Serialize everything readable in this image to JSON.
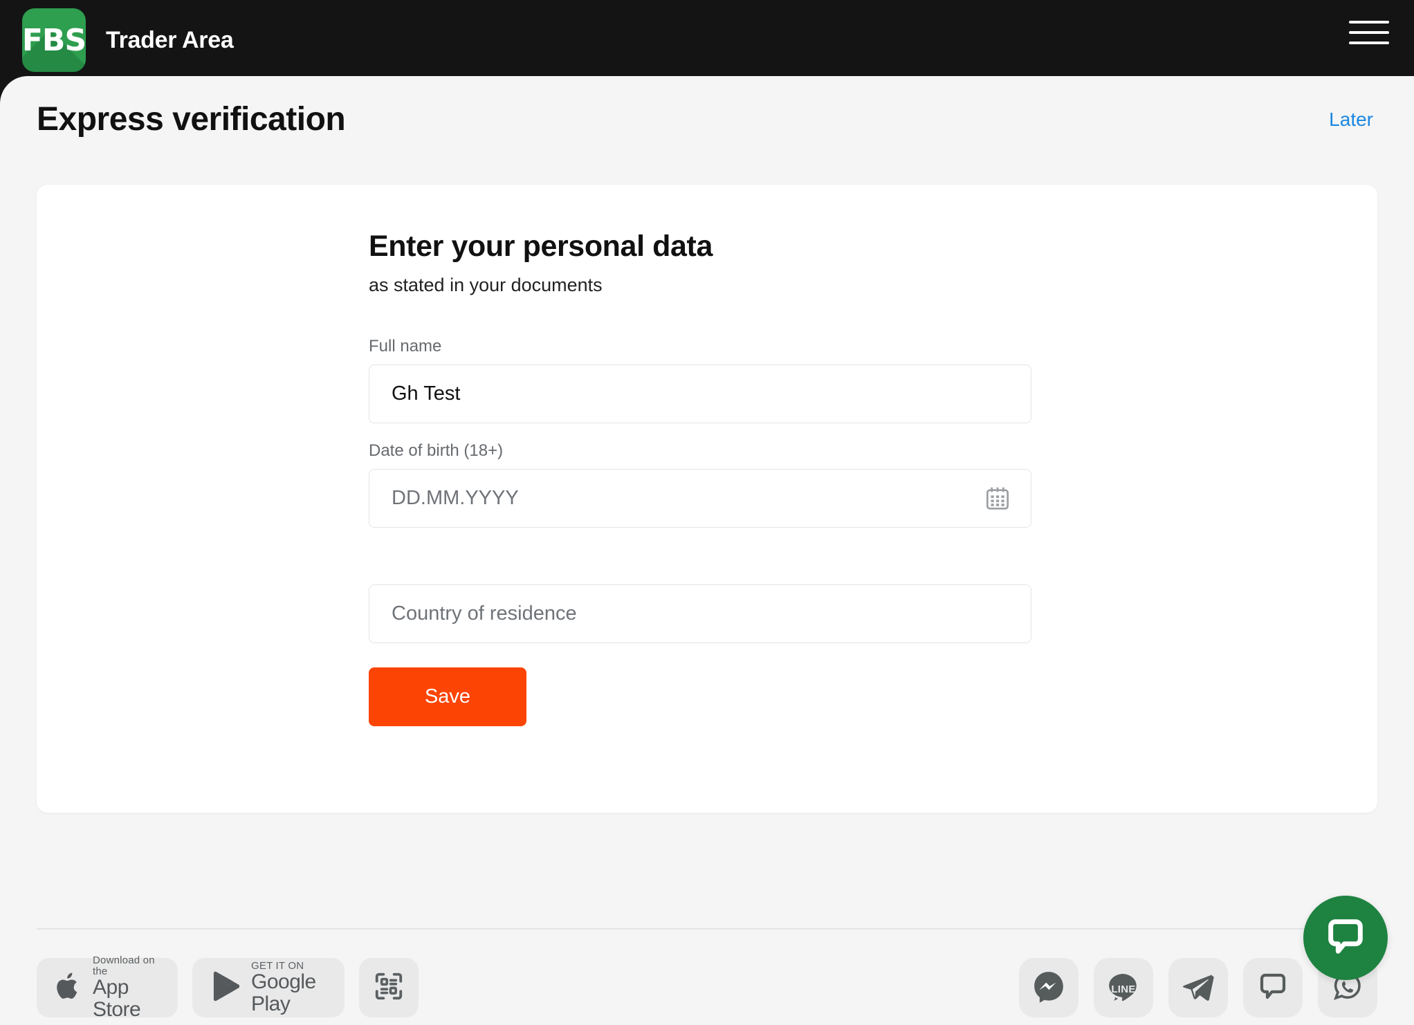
{
  "header": {
    "logo_text": "FBS",
    "brand_title": "Trader Area",
    "menu_icon": "hamburger-menu-icon"
  },
  "page": {
    "title": "Express verification",
    "later_label": "Later"
  },
  "form": {
    "title": "Enter your personal data",
    "subtitle": "as stated in your documents",
    "full_name": {
      "label": "Full name",
      "value": "Gh Test",
      "placeholder": "Full name"
    },
    "date_of_birth": {
      "label": "Date of birth (18+)",
      "value": "",
      "placeholder": "DD.MM.YYYY",
      "icon": "calendar-icon"
    },
    "country": {
      "label": "",
      "value": "",
      "placeholder": "Country of residence"
    },
    "save_label": "Save"
  },
  "footer": {
    "app_store": {
      "small": "Download on the",
      "big": "App Store",
      "icon": "apple-icon"
    },
    "google_play": {
      "small": "GET IT ON",
      "big": "Google Play",
      "icon": "google-play-icon"
    },
    "qr": {
      "icon": "qr-scan-icon"
    },
    "socials": [
      {
        "name": "messenger",
        "icon": "messenger-icon"
      },
      {
        "name": "line",
        "icon": "line-icon",
        "label": "LINE"
      },
      {
        "name": "telegram",
        "icon": "telegram-icon"
      },
      {
        "name": "chat",
        "icon": "chat-bubble-icon"
      },
      {
        "name": "whatsapp",
        "icon": "whatsapp-icon"
      }
    ]
  },
  "chat_widget": {
    "icon": "chat-bubble-icon"
  },
  "colors": {
    "accent": "#fc4404",
    "brand_green": "#2e9e4f",
    "link": "#1a87e0",
    "header_bg": "#141414",
    "page_bg": "#f5f5f5",
    "chat_green": "#1e8241"
  }
}
